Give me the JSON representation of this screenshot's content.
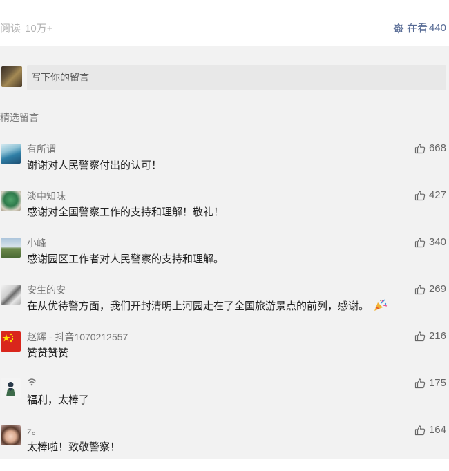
{
  "header": {
    "read_label": "阅读",
    "read_count": "10万+",
    "viewing_label": "在看",
    "viewing_count": "440"
  },
  "comment_box": {
    "placeholder": "写下你的留言"
  },
  "section_title": "精选留言",
  "comments": [
    {
      "name": "有所谓",
      "text": "谢谢对人民警察付出的认可！",
      "likes": "668",
      "avatar": "wave"
    },
    {
      "name": "淡中知味",
      "text": "感谢对全国警察工作的支持和理解！敬礼！",
      "likes": "427",
      "avatar": "green"
    },
    {
      "name": "小峰",
      "text": "感谢园区工作者对人民警察的支持和理解。",
      "likes": "340",
      "avatar": "landscape"
    },
    {
      "name": "安生的安",
      "text": "在从优待警方面，我们开封清明上河园走在了全国旅游景点的前列，感谢。",
      "likes": "269",
      "avatar": "sketch",
      "emoji": "party-popper"
    },
    {
      "name": "赵辉 - 抖音1070212557",
      "text": "赞赞赞赞",
      "likes": "216",
      "avatar": "flag"
    },
    {
      "name": "",
      "text": "福利，太棒了",
      "likes": "175",
      "avatar": "figure",
      "name_icon": "wifi-icon"
    },
    {
      "name": "z。",
      "text": "太棒啦！致敬警察！",
      "likes": "164",
      "avatar": "girl"
    }
  ],
  "colors": {
    "link_blue": "#576b95",
    "background_gray": "#f2f2f2"
  }
}
